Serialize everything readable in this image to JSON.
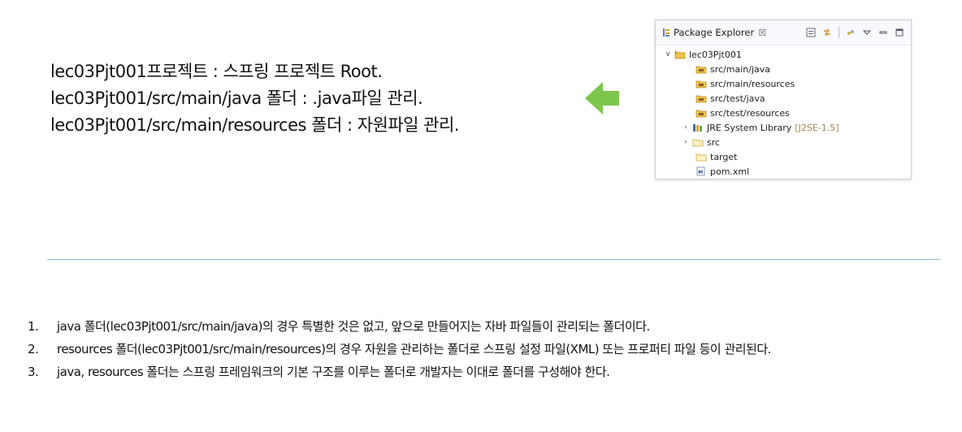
{
  "description_lines": [
    "lec03Pjt001프로젝트 : 스프링 프로젝트 Root.",
    "lec03Pjt001/src/main/java 폴더 : .java파일 관리.",
    "lec03Pjt001/src/main/resources 폴더 : 자원파일 관리."
  ],
  "arrow": {
    "color": "#7dc64b",
    "icon": "arrow-left-icon"
  },
  "package_explorer": {
    "title": "Package Explorer",
    "close_glyph": "☒",
    "project": "lec03Pjt001",
    "items": [
      {
        "label": "src/main/java",
        "icon": "source-folder-icon"
      },
      {
        "label": "src/main/resources",
        "icon": "source-folder-icon"
      },
      {
        "label": "src/test/java",
        "icon": "source-folder-icon"
      },
      {
        "label": "src/test/resources",
        "icon": "source-folder-icon"
      },
      {
        "label": "JRE System Library",
        "suffix": "[J2SE-1.5]",
        "icon": "library-icon",
        "expandable": true
      },
      {
        "label": "src",
        "icon": "folder-icon",
        "expandable": true
      },
      {
        "label": "target",
        "icon": "folder-icon"
      },
      {
        "label": "pom.xml",
        "icon": "maven-file-icon"
      }
    ]
  },
  "notes": [
    {
      "num": "1.",
      "text": "java 폴더(lec03Pjt001/src/main/java)의 경우 특별한 것은 없고, 앞으로 만들어지는 자바 파일들이 관리되는 폴더이다."
    },
    {
      "num": "2.",
      "text": "resources 폴더(lec03Pjt001/src/main/resources)의 경우 자원을 관리하는 폴더로 스프링 설정 파일(XML) 또는 프로퍼티 파일 등이 관리된다."
    },
    {
      "num": "3.",
      "text": "java, resources 폴더는 스프링 프레임워크의 기본 구조를 이루는 폴더로 개발자는 이대로 폴더를 구성해야 한다."
    }
  ],
  "colors": {
    "divider": "#86b8cc",
    "library_suffix": "#a08a4f",
    "folder": "#f0c24c"
  }
}
